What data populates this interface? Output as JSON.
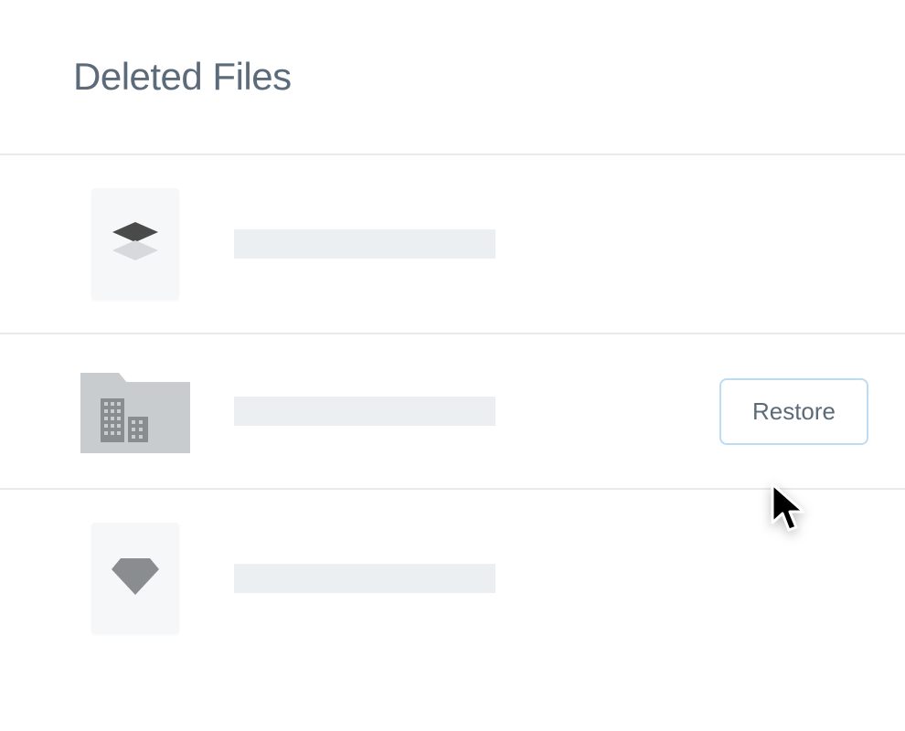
{
  "page": {
    "title": "Deleted Files"
  },
  "rows": [
    {
      "icon": "layers",
      "restore_visible": false
    },
    {
      "icon": "folder-building",
      "restore_visible": true
    },
    {
      "icon": "diamond",
      "restore_visible": false
    }
  ],
  "actions": {
    "restore_label": "Restore"
  }
}
